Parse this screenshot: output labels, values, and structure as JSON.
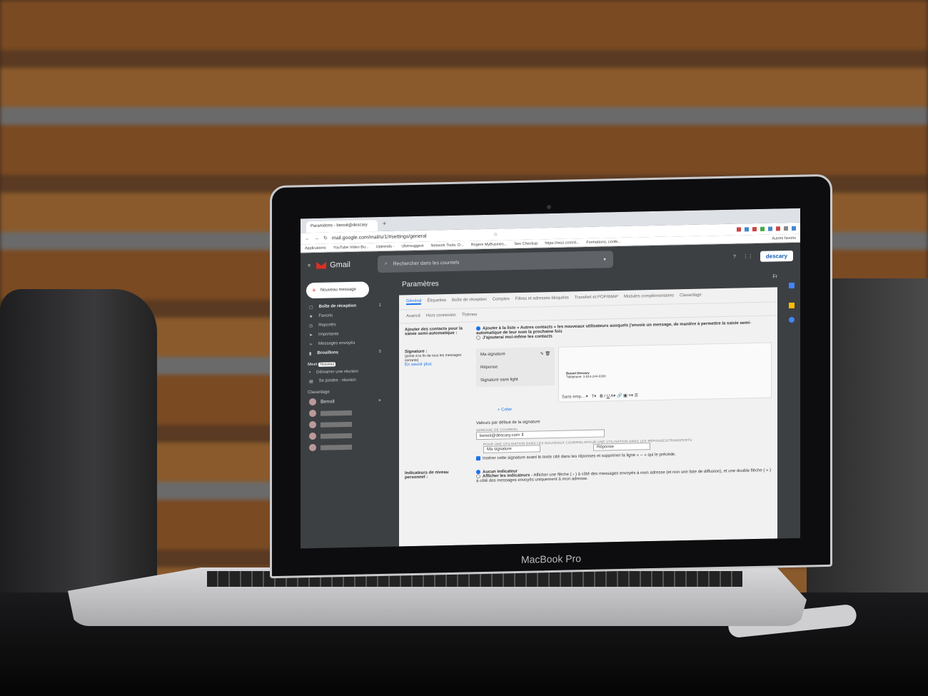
{
  "device": {
    "brand": "MacBook Pro"
  },
  "browser": {
    "tab_title": "Paramètres - benoit@descary",
    "url": "mail.google.com/mail/u/1/#settings/general",
    "bookmarks": [
      "Applications",
      "YouTube Video Bu...",
      "Uptrends -",
      "Ubersuggest",
      "Network Tools: D...",
      "Rogers MyBusines...",
      "Seo Checkup",
      "https://moz.com/d...",
      "Formations, confe...",
      "Autres favoris"
    ]
  },
  "gmail": {
    "app_name": "Gmail",
    "search_placeholder": "Rechercher dans les courriels",
    "account_logo": "descary",
    "lang": "Fr",
    "compose": "Nouveau message",
    "nav": [
      {
        "label": "Boîte de réception",
        "count": "1"
      },
      {
        "label": "Favoris"
      },
      {
        "label": "Reportés"
      },
      {
        "label": "Importants"
      },
      {
        "label": "Messages envoyés"
      },
      {
        "label": "Brouillons",
        "count": "5"
      }
    ],
    "meet": {
      "title": "Meet",
      "badge": "Nouveau",
      "items": [
        "Démarrer une réunion",
        "Se joindre : réunion"
      ]
    },
    "chat": {
      "title": "Clavardage",
      "user": "Benoit"
    },
    "settings": {
      "title": "Paramètres",
      "tabs": [
        "Général",
        "Étiquettes",
        "Boîte de réception",
        "Comptes",
        "Filtres et adresses bloquées",
        "Transfert et POP/IMAP",
        "Modules complémentaires",
        "Clavardage"
      ],
      "subtabs": [
        "Avancé",
        "Hors connexion",
        "Thèmes"
      ],
      "autocomplete": {
        "label": "Ajouter des contacts pour la saisie semi-automatique :",
        "opt1": "Ajouter à la liste « Autres contacts » les nouveaux utilisateurs auxquels j'envoie un message, de manière à permettre la saisie semi-automatique de leur nom la prochaine fois",
        "opt2": "J'ajouterai moi-même les contacts"
      },
      "signature": {
        "label": "Signature :",
        "hint": "(jointe à la fin de tous les messages sortants)",
        "learn": "En savoir plus",
        "list": [
          "Ma signature",
          "Réponse",
          "Signature sans light"
        ],
        "name": "Benoit Descary",
        "phone": "Téléphone: 1-514-244-0300",
        "font": "Sans emp...",
        "create": "+ Créer",
        "defaults_title": "Valeurs par défaut de la signature",
        "email_label": "ADRESSE DE COURRIEL",
        "email": "benoit@descary.com",
        "new_label": "POUR UNE UTILISATION DANS LES NOUVEAUX COURRIELS",
        "reply_label": "POUR UNE UTILISATION DANS LES RÉPONSES/TRANSFERTS",
        "new_val": "Ma signature",
        "reply_val": "Réponse",
        "insert": "Insérer cette signature avant le texte cité dans les réponses et supprimer la ligne « -- » qui le précède."
      },
      "indicators": {
        "label": "Indicateurs de niveau personnel :",
        "opt1": "Aucun indicateur",
        "opt2": "Afficher les indicateurs",
        "opt2_desc": " - Afficher une flèche ( › ) à côté des messages envoyés à mon adresse (et non une liste de diffusion), et une double flèche ( » ) à côté des messages envoyés uniquement à mon adresse."
      }
    }
  }
}
